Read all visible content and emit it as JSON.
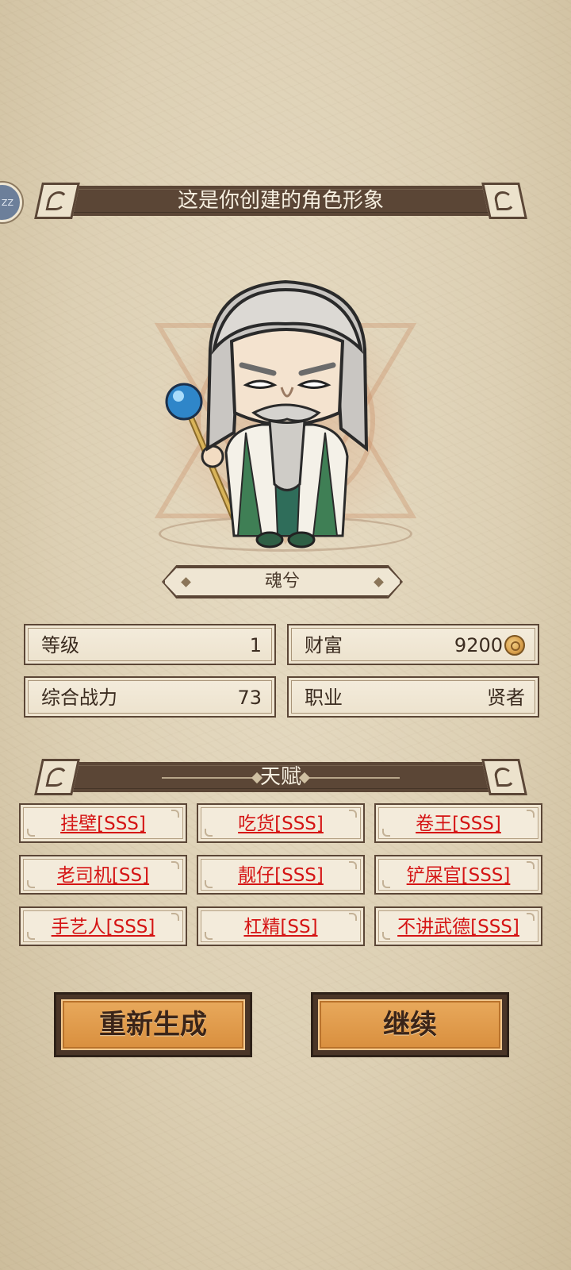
{
  "header": {
    "title": "这是你创建的角色形象"
  },
  "side_badge": {
    "text": "ZZ"
  },
  "character": {
    "name": "魂兮"
  },
  "stats": [
    {
      "label": "等级",
      "value": "1"
    },
    {
      "label": "财富",
      "value": "9200",
      "icon": "coin-icon"
    },
    {
      "label": "综合战力",
      "value": "73"
    },
    {
      "label": "职业",
      "value": "贤者"
    }
  ],
  "talent_section": {
    "title": "天赋"
  },
  "talents": [
    "挂壁[SSS]",
    "吃货[SSS]",
    "卷王[SSS]",
    "老司机[SS]",
    "靓仔[SSS]",
    "铲屎官[SSS]",
    "手艺人[SSS]",
    "杠精[SS]",
    "不讲武德[SSS]"
  ],
  "buttons": {
    "regenerate": "重新生成",
    "continue": "继续"
  },
  "colors": {
    "banner": "#5b4636",
    "talent_text": "#d51414",
    "button": "#e2a050"
  }
}
